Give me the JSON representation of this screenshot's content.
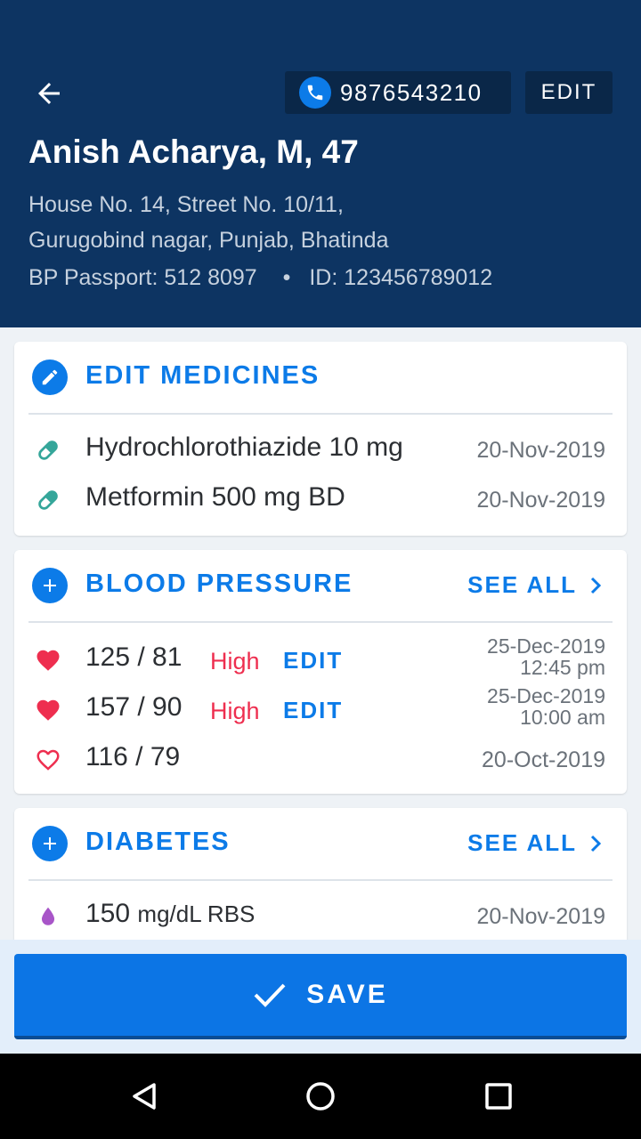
{
  "header": {
    "phone_number": "9876543210",
    "edit_label": "EDIT",
    "patient_name": "Anish Acharya, M, 47",
    "address_line1": "House No. 14, Street No. 10/11,",
    "address_line2": "Gurugobind nagar, Punjab, Bhatinda",
    "passport_label": "BP Passport:",
    "passport_number": "512 8097",
    "separator": "•",
    "id_label": "ID:",
    "id_number": "123456789012"
  },
  "medicines": {
    "title": "EDIT MEDICINES",
    "items": [
      {
        "name": "Hydrochlorothiazide 10 mg",
        "date": "20-Nov-2019",
        "icon": "pill-icon"
      },
      {
        "name": "Metformin 500 mg BD",
        "date": "20-Nov-2019",
        "icon": "pill-icon"
      }
    ]
  },
  "blood_pressure": {
    "title": "BLOOD PRESSURE",
    "see_all": "SEE ALL",
    "items": [
      {
        "value": "125 / 81",
        "status": "High",
        "edit": "EDIT",
        "date": "25-Dec-2019",
        "time": "12:45 pm",
        "icon": "heart-filled-icon"
      },
      {
        "value": "157 / 90",
        "status": "High",
        "edit": "EDIT",
        "date": "25-Dec-2019",
        "time": "10:00 am",
        "icon": "heart-filled-icon"
      },
      {
        "value": "116 / 79",
        "date": "20-Oct-2019",
        "icon": "heart-outline-icon"
      }
    ]
  },
  "diabetes": {
    "title": "DIABETES",
    "see_all": "SEE ALL",
    "items": [
      {
        "value": "150",
        "unit": "mg/dL RBS",
        "date": "20-Nov-2019",
        "icon": "drop-icon"
      }
    ]
  },
  "footer": {
    "save_label": "SAVE"
  },
  "colors": {
    "header_bg": "#0d3462",
    "accent": "#0c7be8",
    "high": "#ee2e4f",
    "pill": "#35a69a",
    "drop": "#a855c8"
  }
}
